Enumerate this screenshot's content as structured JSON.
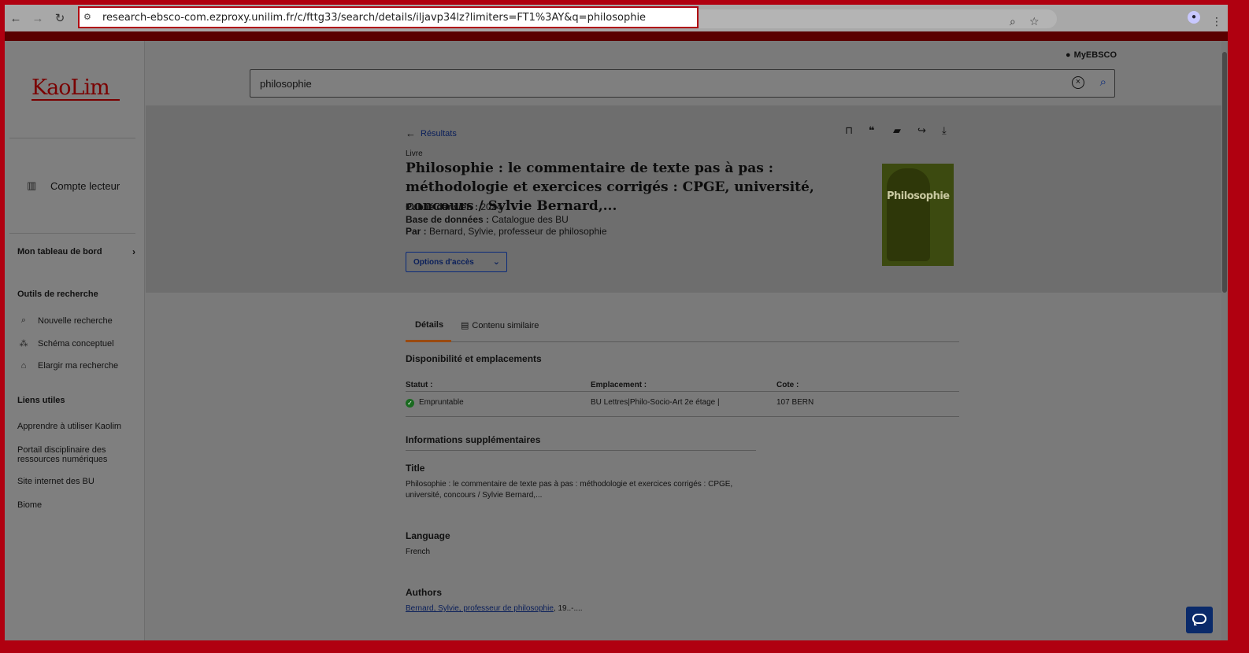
{
  "browser": {
    "url": "research-ebsco-com.ezproxy.unilim.fr/c/fttg33/search/details/iljavp34lz?limiters=FT1%3AY&q=philosophie"
  },
  "header": {
    "myebsco_label": "MyEBSCO",
    "search_value": "philosophie"
  },
  "sidebar": {
    "logo": "KaoLim",
    "account_label": "Compte lecteur",
    "dashboard_label": "Mon tableau de bord",
    "tools_heading": "Outils de recherche",
    "tools": [
      {
        "label": "Nouvelle recherche",
        "icon": "search-icon"
      },
      {
        "label": "Schéma conceptuel",
        "icon": "concept-map-icon"
      },
      {
        "label": "Elargir ma recherche",
        "icon": "library-icon"
      }
    ],
    "links_heading": "Liens utiles",
    "links": [
      "Apprendre à utiliser Kaolim",
      "Portail disciplinaire des ressources numériques",
      "Site internet des BU",
      "Biome"
    ]
  },
  "record": {
    "back_label": "Résultats",
    "doc_type": "Livre",
    "title": "Philosophie : le commentaire de texte pas à pas : méthodologie et exercices corrigés : CPGE, université, concours / Sylvie Bernard,...",
    "published_label": "Publié dans/en :",
    "published_value": "2024",
    "database_label": "Base de données :",
    "database_value": "Catalogue des BU",
    "by_label": "Par :",
    "by_value": "Bernard, Sylvie, professeur de philosophie",
    "access_button": "Options d'accès",
    "cover_title": "Philosophie"
  },
  "tabs": [
    "Détails",
    "Contenu similaire"
  ],
  "availability": {
    "heading": "Disponibilité et emplacements",
    "columns": [
      "Statut :",
      "Emplacement :",
      "Cote :"
    ],
    "row": {
      "status": "Empruntable",
      "location": "BU Lettres|Philo-Socio-Art 2e étage |",
      "call_number": "107 BERN"
    }
  },
  "supplementary": {
    "heading": "Informations supplémentaires",
    "title_label": "Title",
    "title_value": "Philosophie : le commentaire de texte pas à pas : méthodologie et exercices corrigés : CPGE, université, concours / Sylvie Bernard,...",
    "language_label": "Language",
    "language_value": "French",
    "authors_label": "Authors",
    "authors_link": "Bernard, Sylvie, professeur de philosophie",
    "authors_suffix": ", 19..-...."
  },
  "colors": {
    "frame": "#b00010",
    "link": "#0a1f5a",
    "available": "#1a6a20"
  }
}
